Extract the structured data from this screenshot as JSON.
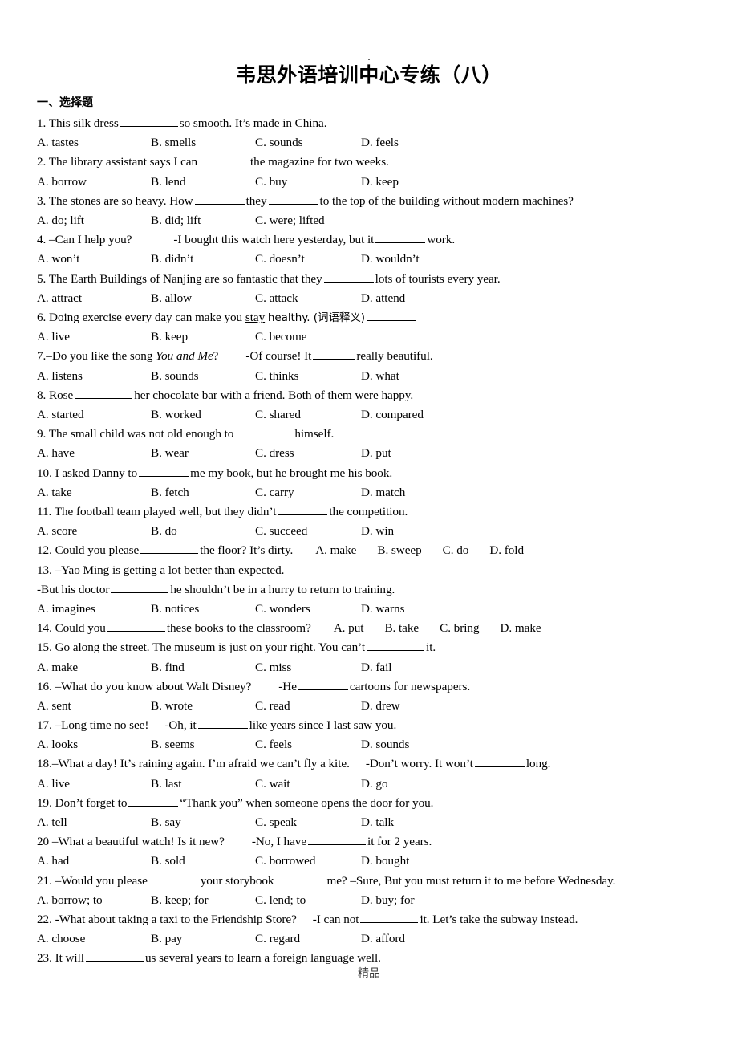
{
  "document": {
    "top_mark": ".",
    "title": "韦思外语培训中心专练（八）",
    "section_heading": "一、选择题",
    "watermark": "精品"
  },
  "questions": [
    {
      "number": "1.",
      "stem_before": "1. This silk dress",
      "stem_after": "so smooth. It’s made in China.",
      "options_layout": "columns",
      "options": [
        "A. tastes",
        "B. smells",
        "C. sounds",
        "D. feels"
      ]
    },
    {
      "number": "2.",
      "stem_before": "2. The library assistant says I can",
      "stem_after": "the magazine for two weeks.",
      "options_layout": "columns",
      "options": [
        "A. borrow",
        "B. lend",
        "C. buy",
        "D. keep"
      ]
    },
    {
      "number": "3.",
      "stem_before": "3. The stones are so heavy. How",
      "stem_mid": "they",
      "stem_after": "to the top of the building without modern machines?",
      "options_layout": "columns",
      "options": [
        "A. do; lift",
        "B. did; lift",
        "C. were; lifted"
      ]
    },
    {
      "number": "4.",
      "stem_before": "4. –Can I help you?",
      "stem_mid": "-I bought this watch here yesterday, but it",
      "stem_after": "work.",
      "options_layout": "columns",
      "options": [
        "A. won’t",
        "B. didn’t",
        "C. doesn’t",
        "D. wouldn’t"
      ]
    },
    {
      "number": "5.",
      "stem_before": "5. The Earth Buildings of Nanjing are so fantastic that they",
      "stem_after": "lots of tourists every year.",
      "options_layout": "columns",
      "options": [
        "A. attract",
        "B. allow",
        "C. attack",
        "D. attend"
      ]
    },
    {
      "number": "6.",
      "stem_before": "6. Doing exercise every day can make you",
      "stem_underlined": "stay",
      "stem_after": "healthy. (词语释义)",
      "options_layout": "columns",
      "options": [
        "A. live",
        "B. keep",
        "C. become"
      ]
    },
    {
      "number": "7.",
      "stem_before": "7.–Do you like the song",
      "stem_italic": "You and Me",
      "stem_mid": "?",
      "stem_mid2": "-Of course! It",
      "stem_after": "really beautiful.",
      "options_layout": "columns",
      "options": [
        "A. listens",
        "B. sounds",
        "C. thinks",
        "D. what"
      ]
    },
    {
      "number": "8.",
      "stem_before": "8. Rose",
      "stem_after": "her chocolate bar with a friend. Both of them were happy.",
      "options_layout": "columns",
      "options": [
        "A. started",
        "B. worked",
        "C. shared",
        "D. compared"
      ]
    },
    {
      "number": "9.",
      "stem_before": "9. The small child was not old enough to",
      "stem_after": "himself.",
      "options_layout": "columns",
      "options": [
        "A. have",
        "B. wear",
        "C. dress",
        "D. put"
      ]
    },
    {
      "number": "10.",
      "stem_before": "10. I asked Danny to",
      "stem_after": "me my book, but he brought me his book.",
      "options_layout": "columns",
      "options": [
        "A. take",
        "B. fetch",
        "C. carry",
        "D. match"
      ]
    },
    {
      "number": "11.",
      "stem_before": "11. The football team played well, but they didn’t",
      "stem_after": "the competition.",
      "options_layout": "columns",
      "options": [
        "A. score",
        "B. do",
        "C. succeed",
        "D. win"
      ]
    },
    {
      "number": "12.",
      "stem_before": "12. Could you please",
      "stem_after": "the floor? It’s dirty.",
      "options_layout": "inline",
      "options": [
        "A. make",
        "B. sweep",
        "C. do",
        "D. fold"
      ]
    },
    {
      "number": "13.",
      "stem_line1": "13. –Yao Ming is getting a lot better than expected.",
      "stem_before": "-But his doctor",
      "stem_after": "he shouldn’t be in a hurry to return to training.",
      "options_layout": "columns",
      "options": [
        "A. imagines",
        "B. notices",
        "C. wonders",
        "D. warns"
      ]
    },
    {
      "number": "14.",
      "stem_before": "14. Could you",
      "stem_after": "these books to the classroom?",
      "options_layout": "inline",
      "options": [
        "A. put",
        "B. take",
        "C. bring",
        "D. make"
      ]
    },
    {
      "number": "15.",
      "stem_before": "15. Go along the street. The museum is just on your right. You can’t",
      "stem_after": "it.",
      "options_layout": "columns",
      "options": [
        "A. make",
        "B. find",
        "C. miss",
        "D. fail"
      ]
    },
    {
      "number": "16.",
      "stem_before": "16. –What do you know about Walt Disney?",
      "stem_mid": "-He",
      "stem_after": "cartoons for newspapers.",
      "options_layout": "columns",
      "options": [
        "A. sent",
        "B. wrote",
        "C. read",
        "D. drew"
      ]
    },
    {
      "number": "17.",
      "stem_before": "17. –Long time no see!",
      "stem_mid": "-Oh, it",
      "stem_after": "like years since I last saw you.",
      "options_layout": "columns",
      "options": [
        "A. looks",
        "B. seems",
        "C. feels",
        "D. sounds"
      ]
    },
    {
      "number": "18.",
      "stem_before": "18.–What a day! It’s raining again. I’m afraid we can’t fly a kite.",
      "stem_mid": "-Don’t worry. It won’t",
      "stem_after": "long.",
      "options_layout": "columns",
      "options": [
        "A. live",
        "B. last",
        "C. wait",
        "D. go"
      ]
    },
    {
      "number": "19.",
      "stem_before": "19. Don’t forget to",
      "stem_after": "“Thank you” when someone opens the door for you.",
      "options_layout": "columns",
      "options": [
        "A. tell",
        "B. say",
        "C. speak",
        "D. talk"
      ]
    },
    {
      "number": "20",
      "stem_before": "20 –What a beautiful watch! Is it new?",
      "stem_mid": "-No, I have",
      "stem_after": "it for 2 years.",
      "options_layout": "columns",
      "options": [
        "A. had",
        "B. sold",
        "C. borrowed",
        "D. bought"
      ]
    },
    {
      "number": "21.",
      "stem_before": "21. –Would you please",
      "stem_mid": "your storybook",
      "stem_after": "me? –Sure, But you must return it to me before Wednesday.",
      "options_layout": "columns",
      "options": [
        "A. borrow; to",
        "B. keep; for",
        "C. lend; to",
        "D. buy; for"
      ]
    },
    {
      "number": "22.",
      "stem_before": "22. -What about taking a taxi to the Friendship Store?",
      "stem_mid": "-I can not",
      "stem_after": "it. Let’s take the subway instead.",
      "options_layout": "columns",
      "options": [
        "A. choose",
        "B. pay",
        "C. regard",
        "D. afford"
      ]
    },
    {
      "number": "23.",
      "stem_before": "23. It will",
      "stem_after": "us several years to learn a foreign language well.",
      "options_layout": "none",
      "options": []
    }
  ]
}
